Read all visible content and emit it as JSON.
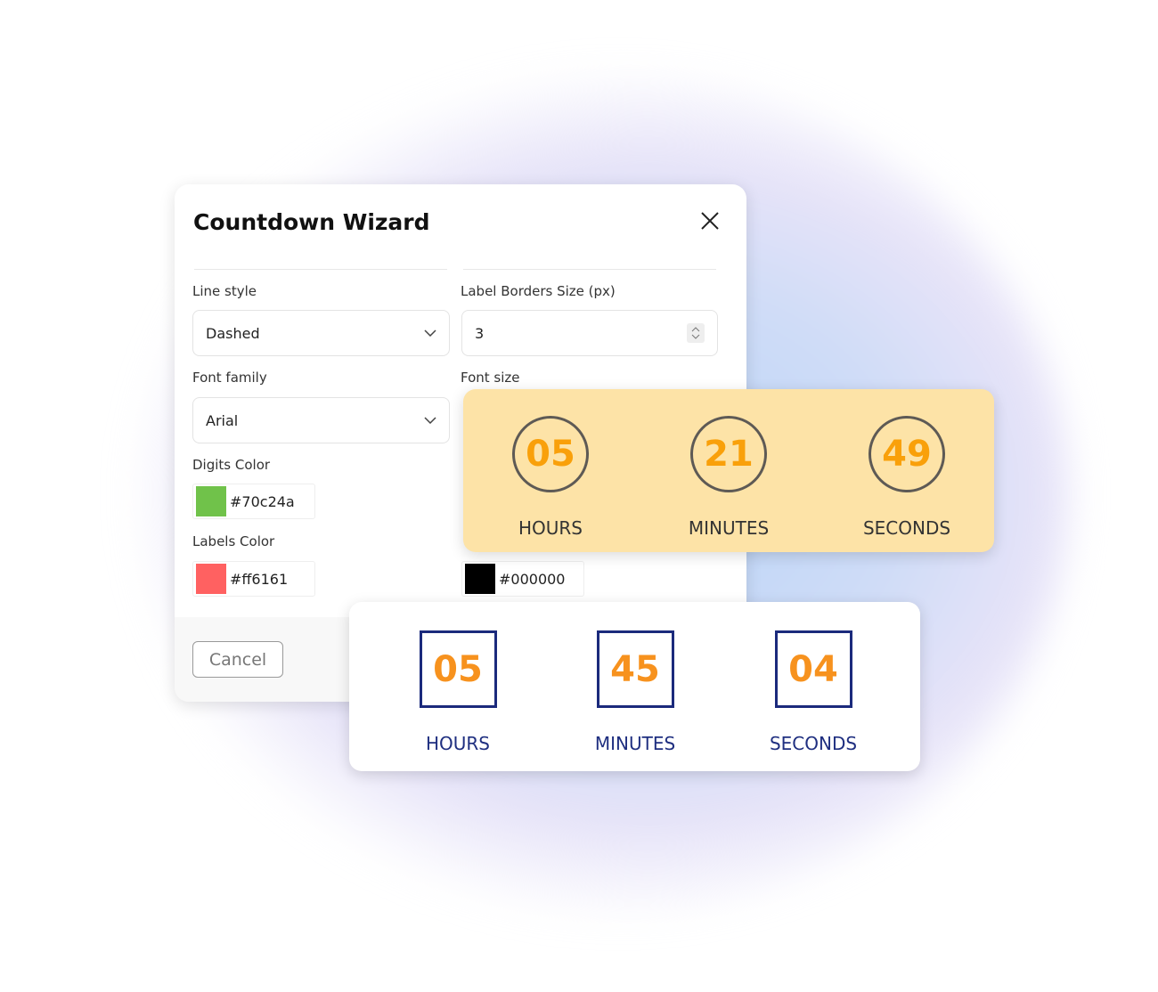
{
  "dialog": {
    "title": "Countdown Wizard",
    "line_style": {
      "label": "Line style",
      "value": "Dashed"
    },
    "border_size": {
      "label": "Label Borders Size (px)",
      "value": "3"
    },
    "font_family": {
      "label": "Font family",
      "value": "Arial"
    },
    "font_size": {
      "label": "Font size"
    },
    "digits_color": {
      "label": "Digits Color",
      "value": "#70c24a"
    },
    "labels_color": {
      "label": "Labels Color",
      "value": "#ff6161"
    },
    "other_color": {
      "value": "#000000"
    },
    "cancel": "Cancel"
  },
  "preview_circle": {
    "bg": "#fde3a7",
    "units": [
      {
        "value": "05",
        "label": "HOURS"
      },
      {
        "value": "21",
        "label": "MINUTES"
      },
      {
        "value": "49",
        "label": "SECONDS"
      }
    ]
  },
  "preview_square": {
    "units": [
      {
        "value": "05",
        "label": "HOURS"
      },
      {
        "value": "45",
        "label": "MINUTES"
      },
      {
        "value": "04",
        "label": "SECONDS"
      }
    ]
  }
}
